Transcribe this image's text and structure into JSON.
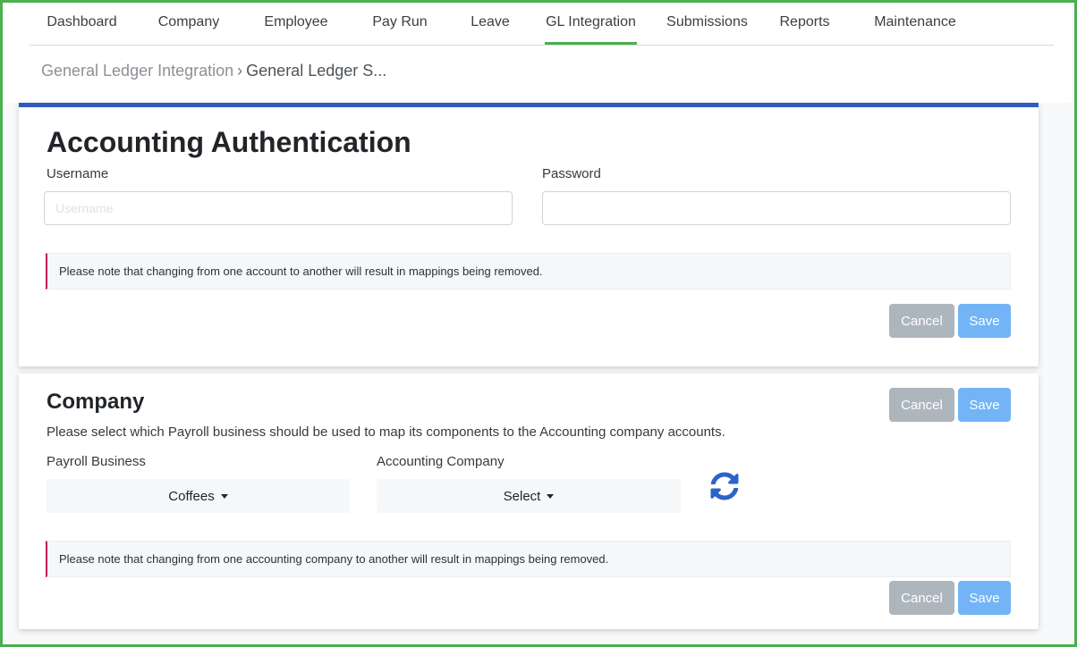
{
  "nav": {
    "items": [
      {
        "label": "Dashboard"
      },
      {
        "label": "Company"
      },
      {
        "label": "Employee"
      },
      {
        "label": "Pay Run"
      },
      {
        "label": "Leave"
      },
      {
        "label": "GL Integration",
        "active": true
      },
      {
        "label": "Submissions"
      },
      {
        "label": "Reports"
      },
      {
        "label": "Maintenance"
      }
    ]
  },
  "breadcrumb": {
    "parent": "General Ledger Integration",
    "separator": "›",
    "current": "General Ledger S..."
  },
  "auth": {
    "title": "Accounting Authentication",
    "username_label": "Username",
    "username_value": "",
    "username_placeholder": "Username",
    "password_label": "Password",
    "password_value": "",
    "note": "Please note that changing from one account to another will result in mappings being removed.",
    "cancel_label": "Cancel",
    "save_label": "Save"
  },
  "company": {
    "title": "Company",
    "description": "Please select which Payroll business should be used to map its components to the Accounting company accounts.",
    "payroll_label": "Payroll Business",
    "payroll_value": "Coffees",
    "accounting_label": "Accounting Company",
    "accounting_value": "Select",
    "refresh_icon": "refresh-icon",
    "note": "Please note that changing from one accounting company to another will result in mappings being removed.",
    "cancel_label": "Cancel",
    "save_label": "Save"
  },
  "colors": {
    "frame": "#4caf50",
    "active_tab": "#4caf50",
    "card_accent": "#2f5bbd",
    "note_border": "#c2185b",
    "cancel_bg": "#adb5bd",
    "save_bg": "#72b4f5",
    "refresh_icon": "#2c63c7"
  }
}
